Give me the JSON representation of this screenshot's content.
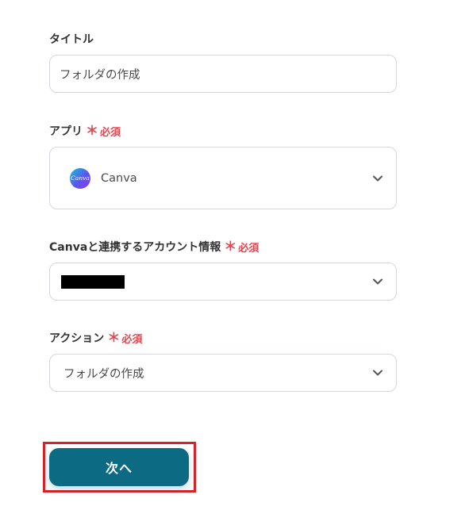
{
  "form": {
    "title_field": {
      "label": "タイトル",
      "value": "フォルダの作成"
    },
    "app_field": {
      "label": "アプリ",
      "required_mark": "＊",
      "required_text": "必須",
      "value": "Canva",
      "icon": "canva-logo-icon",
      "logo_text": "Canva"
    },
    "account_field": {
      "label": "Canvaと連携するアカウント情報",
      "required_mark": "＊",
      "required_text": "必須"
    },
    "action_field": {
      "label": "アクション",
      "required_mark": "＊",
      "required_text": "必須",
      "value": "フォルダの作成"
    },
    "next_button": {
      "label": "次へ"
    }
  },
  "colors": {
    "primary_button": "#0c6a83",
    "required": "#e0464f",
    "highlight_border": "#d8222a"
  }
}
